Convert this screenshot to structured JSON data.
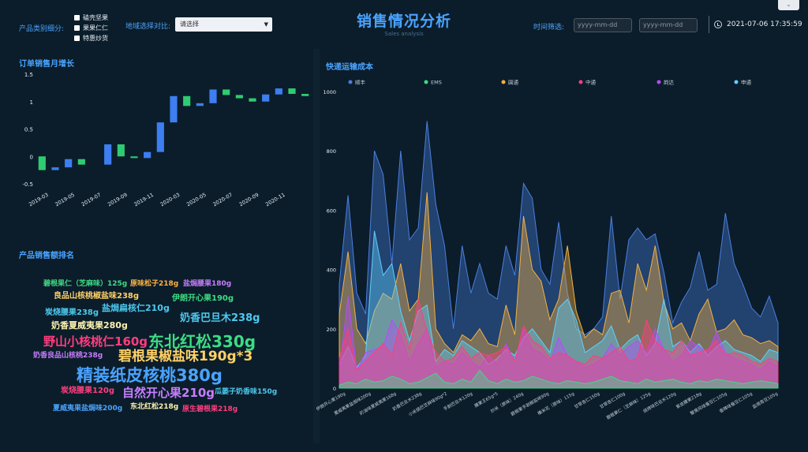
{
  "header": {
    "title": "销售情况分析",
    "subtitle": "Sales analysis",
    "category_label": "产品类别细分:",
    "categories": [
      "磕壳坚果",
      "果果仁仁",
      "特惠炒货"
    ],
    "region_label": "地域选择对比:",
    "region_select_value": "请选择",
    "time_label": "时间筛选:",
    "date_start_placeholder": "yyyy-mm-dd",
    "date_end_placeholder": "yyyy-mm-dd",
    "datetime": "2021-07-06 17:35:59"
  },
  "panels": {
    "monthly_growth_title": "订单销售月增长",
    "ranking_title": "产品销售额排名",
    "shipping_title": "快递运输成本"
  },
  "chart_data": [
    {
      "type": "bar",
      "title": "订单销售月增长",
      "ylim": [
        -0.5,
        1.5
      ],
      "yticks": [
        -0.5,
        0,
        0.5,
        1,
        1.5
      ],
      "xtick_labels": [
        "2019-03",
        "2019-05",
        "2019-07",
        "2019-09",
        "2019-11",
        "2020-03",
        "2020-05",
        "2020-07",
        "2020-09",
        "2020-11"
      ],
      "bars": [
        {
          "color": "green",
          "start": 0.0,
          "end": -0.25
        },
        {
          "color": "blue",
          "start": -0.25,
          "end": -0.2
        },
        {
          "color": "blue",
          "start": -0.2,
          "end": -0.05
        },
        {
          "color": "green",
          "start": -0.05,
          "end": -0.15
        },
        {
          "color": "none",
          "start": -0.15,
          "end": -0.15
        },
        {
          "color": "blue",
          "start": -0.15,
          "end": 0.22
        },
        {
          "color": "green",
          "start": 0.22,
          "end": 0.0
        },
        {
          "color": "green",
          "start": 0.0,
          "end": -0.03
        },
        {
          "color": "blue",
          "start": -0.03,
          "end": 0.08
        },
        {
          "color": "blue",
          "start": 0.08,
          "end": 0.62
        },
        {
          "color": "blue",
          "start": 0.62,
          "end": 1.1
        },
        {
          "color": "green",
          "start": 1.1,
          "end": 0.92
        },
        {
          "color": "blue",
          "start": 0.92,
          "end": 0.97
        },
        {
          "color": "blue",
          "start": 0.97,
          "end": 1.22
        },
        {
          "color": "green",
          "start": 1.22,
          "end": 1.12
        },
        {
          "color": "green",
          "start": 1.12,
          "end": 1.06
        },
        {
          "color": "green",
          "start": 1.06,
          "end": 1.0
        },
        {
          "color": "blue",
          "start": 1.0,
          "end": 1.13
        },
        {
          "color": "blue",
          "start": 1.13,
          "end": 1.24
        },
        {
          "color": "green",
          "start": 1.24,
          "end": 1.14
        },
        {
          "color": "green",
          "start": 1.14,
          "end": 1.1
        }
      ]
    },
    {
      "type": "wordcloud",
      "title": "产品销售额排名",
      "words": [
        {
          "text": "碧根果仁（芝麻味）125g",
          "color": "#3ddc84",
          "size": 9
        },
        {
          "text": "原味松子218g",
          "color": "#ffb347",
          "size": 9
        },
        {
          "text": "盐焗腰果180g",
          "color": "#c77dff",
          "size": 9
        },
        {
          "text": "良品山核桃椒盐味238g",
          "color": "#ffd166",
          "size": 10
        },
        {
          "text": "伊朗开心果190g",
          "color": "#3ddc84",
          "size": 10
        },
        {
          "text": "盐焗扁核仁210g",
          "color": "#4cc9f0",
          "size": 11
        },
        {
          "text": "炭烧腰果238g",
          "color": "#4cc9f0",
          "size": 10
        },
        {
          "text": "奶香巴旦木238g",
          "color": "#4cc9f0",
          "size": 13
        },
        {
          "text": "奶香夏威夷果280g",
          "color": "#fff3b0",
          "size": 11
        },
        {
          "text": "野山小核桃仁160g",
          "color": "#ff3d7f",
          "size": 15
        },
        {
          "text": "东北红松330g",
          "color": "#3ddc84",
          "size": 20
        },
        {
          "text": "奶香良品山核桃238g",
          "color": "#c77dff",
          "size": 9
        },
        {
          "text": "碧根果椒盐味190g*3",
          "color": "#ffd166",
          "size": 17
        },
        {
          "text": "精装纸皮核桃380g",
          "color": "#4aa3ff",
          "size": 21
        },
        {
          "text": "炭烧腰果120g",
          "color": "#ff3d7f",
          "size": 10
        },
        {
          "text": "自然开心果210g",
          "color": "#c77dff",
          "size": 15
        },
        {
          "text": "瓜蒌子奶香味150g",
          "color": "#4cc9f0",
          "size": 9
        },
        {
          "text": "夏威夷果盐焗味200g",
          "color": "#4aa3ff",
          "size": 9
        },
        {
          "text": "东北红松218g",
          "color": "#fff3b0",
          "size": 9
        },
        {
          "text": "原生碧根果218g",
          "color": "#ff3d7f",
          "size": 9
        }
      ]
    },
    {
      "type": "area",
      "title": "快递运输成本",
      "ylim": [
        0,
        1000
      ],
      "yticks": [
        0,
        200,
        400,
        600,
        800,
        1000
      ],
      "legend_position": "top",
      "xtick_labels": [
        "伊朗开心果190g",
        "夏威夷果盐焗味200g",
        "奶油味夏威夷果168g",
        "奶香巴旦木238g",
        "小米锅巴芝麻味90g*2",
        "手剥巴旦木120g",
        "腰果王65g*5",
        "炒米（原味）240g",
        "碧根果手剥椒盐味90g",
        "榛米花（原味）115g",
        "甘草杏仁150g",
        "甘草杏仁100g",
        "碧根果仁（芝麻味）125g",
        "烧烤味巴旦木120g",
        "紫皮腰果218g",
        "蟹黄风味蚕豆仁105g",
        "香辣味蚕豆仁105g",
        "盐焗青豆105g"
      ],
      "series": [
        {
          "name": "顺丰",
          "color": "#4a7fe0",
          "values": [
            350,
            650,
            320,
            250,
            800,
            720,
            420,
            800,
            500,
            540,
            900,
            620,
            480,
            200,
            480,
            320,
            420,
            320,
            300,
            480,
            380,
            690,
            640,
            400,
            350,
            560,
            320,
            200,
            180,
            200,
            240,
            580,
            300,
            500,
            540,
            500,
            520,
            390,
            220,
            290,
            340,
            460,
            330,
            350,
            590,
            420,
            350,
            270,
            240,
            310,
            220
          ]
        },
        {
          "name": "EMS",
          "color": "#3ddc84",
          "values": [
            10,
            20,
            15,
            30,
            20,
            25,
            40,
            30,
            15,
            20,
            35,
            50,
            20,
            15,
            30,
            20,
            60,
            25,
            15,
            30,
            20,
            25,
            40,
            30,
            20,
            15,
            25,
            20,
            15,
            20,
            30,
            40,
            25,
            20,
            15,
            30,
            20,
            25,
            30,
            20,
            15,
            25,
            20,
            30,
            25,
            20,
            15,
            20,
            25,
            20,
            15
          ]
        },
        {
          "name": "圆通",
          "color": "#f5b041",
          "values": [
            250,
            460,
            200,
            150,
            260,
            320,
            300,
            420,
            260,
            300,
            660,
            200,
            150,
            120,
            180,
            160,
            200,
            150,
            140,
            280,
            180,
            580,
            400,
            360,
            230,
            300,
            480,
            260,
            170,
            200,
            180,
            320,
            330,
            220,
            420,
            330,
            480,
            290,
            200,
            220,
            160,
            250,
            300,
            190,
            200,
            230,
            180,
            170,
            150,
            160,
            140
          ]
        },
        {
          "name": "中通",
          "color": "#ff3d7f",
          "values": [
            100,
            200,
            60,
            90,
            120,
            150,
            110,
            220,
            130,
            300,
            190,
            120,
            90,
            100,
            140,
            100,
            120,
            110,
            120,
            140,
            90,
            210,
            160,
            140,
            100,
            120,
            110,
            90,
            80,
            110,
            100,
            120,
            140,
            90,
            100,
            230,
            160,
            130,
            120,
            160,
            110,
            120,
            130,
            160,
            110,
            120,
            110,
            90,
            80,
            100,
            90
          ]
        },
        {
          "name": "韵达",
          "color": "#b44cff",
          "values": [
            50,
            310,
            60,
            120,
            130,
            140,
            230,
            180,
            90,
            150,
            200,
            70,
            90,
            80,
            120,
            90,
            70,
            110,
            80,
            150,
            90,
            200,
            130,
            120,
            90,
            170,
            110,
            90,
            70,
            80,
            100,
            150,
            110,
            140,
            160,
            120,
            200,
            130,
            90,
            110,
            160,
            140,
            120,
            190,
            120,
            100,
            90,
            80,
            60,
            90,
            70
          ]
        },
        {
          "name": "申通",
          "color": "#5ed0ff",
          "values": [
            80,
            140,
            70,
            110,
            530,
            380,
            420,
            260,
            160,
            260,
            280,
            90,
            130,
            110,
            160,
            140,
            120,
            80,
            100,
            130,
            110,
            170,
            200,
            160,
            120,
            270,
            300,
            230,
            120,
            140,
            160,
            210,
            130,
            160,
            180,
            110,
            150,
            300,
            140,
            160,
            120,
            150,
            110,
            140,
            160,
            130,
            120,
            110,
            90,
            130,
            120
          ]
        }
      ]
    }
  ]
}
